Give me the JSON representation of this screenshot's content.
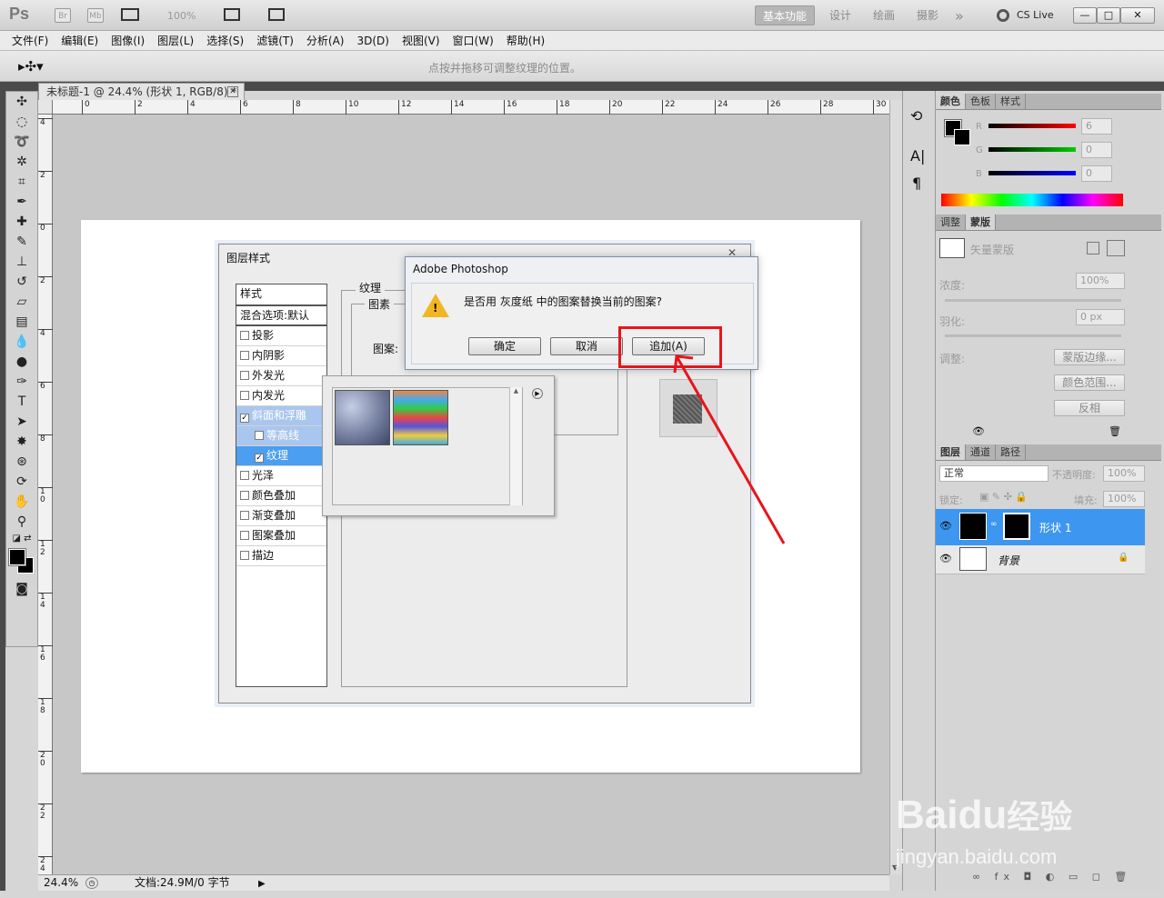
{
  "app": {
    "logo": "Ps",
    "br": "Br",
    "mb": "Mb",
    "zoom": "100%",
    "workspaces": [
      "基本功能",
      "设计",
      "绘画",
      "摄影"
    ],
    "more": "»",
    "cs_live": "CS Live",
    "win_min": "—",
    "win_max": "□",
    "win_close": "✕"
  },
  "menu": [
    "文件(F)",
    "编辑(E)",
    "图像(I)",
    "图层(L)",
    "选择(S)",
    "滤镜(T)",
    "分析(A)",
    "3D(D)",
    "视图(V)",
    "窗口(W)",
    "帮助(H)"
  ],
  "options_hint": "点按并拖移可调整纹理的位置。",
  "document": {
    "tab_title": "未标题-1 @ 24.4% (形状 1, RGB/8) *",
    "h_ruler": [
      "0",
      "2",
      "4",
      "6",
      "8",
      "10",
      "12",
      "14",
      "16",
      "18",
      "20",
      "22",
      "24",
      "26",
      "28",
      "30"
    ],
    "v_ruler": [
      "4",
      "2",
      "0",
      "2",
      "4",
      "6",
      "8",
      "1 0",
      "1 2",
      "1 4",
      "1 6",
      "1 8",
      "2 0",
      "2 2",
      "2 4"
    ],
    "zoom": "24.4%",
    "doc_info": "文档:24.9M/0 字节"
  },
  "layer_style_dialog": {
    "title": "图层样式",
    "styles_header": "样式",
    "blend_options": "混合选项:默认",
    "items": [
      {
        "label": "投影",
        "checked": false
      },
      {
        "label": "内阴影",
        "checked": false
      },
      {
        "label": "外发光",
        "checked": false
      },
      {
        "label": "内发光",
        "checked": false
      },
      {
        "label": "斜面和浮雕",
        "checked": true
      },
      {
        "label": "等高线",
        "checked": false
      },
      {
        "label": "纹理",
        "checked": true
      },
      {
        "label": "光泽",
        "checked": false
      },
      {
        "label": "颜色叠加",
        "checked": false
      },
      {
        "label": "渐变叠加",
        "checked": false
      },
      {
        "label": "图案叠加",
        "checked": false
      },
      {
        "label": "描边",
        "checked": false
      }
    ],
    "section_title": "纹理",
    "group_title": "图素",
    "pattern_label": "图案:"
  },
  "message_dialog": {
    "title": "Adobe Photoshop",
    "message": "是否用 灰度纸 中的图案替换当前的图案?",
    "ok": "确定",
    "cancel": "取消",
    "append": "追加(A)"
  },
  "color_panel": {
    "tabs": [
      "颜色",
      "色板",
      "样式"
    ],
    "r_label": "R",
    "g_label": "G",
    "b_label": "B",
    "r": "6",
    "g": "0",
    "b": "0"
  },
  "masks_panel": {
    "tabs": [
      "调整",
      "蒙版"
    ],
    "vector_mask": "矢量蒙版",
    "density_label": "浓度:",
    "density": "100%",
    "feather_label": "羽化:",
    "feather": "0 px",
    "refine_label": "调整:",
    "mask_edge": "蒙版边缘...",
    "color_range": "颜色范围...",
    "invert": "反相"
  },
  "layers_panel": {
    "tabs": [
      "图层",
      "通道",
      "路径"
    ],
    "blend_mode": "正常",
    "opacity_label": "不透明度:",
    "opacity": "100%",
    "lock_label": "锁定:",
    "fill_label": "填充:",
    "fill": "100%",
    "layers": [
      {
        "name": "形状 1",
        "selected": true
      },
      {
        "name": "背景",
        "selected": false
      }
    ]
  },
  "watermark": {
    "brand": "Bai",
    "brand2": "du",
    "cn": "经验",
    "url": "jingyan.baidu.com"
  },
  "colors": {
    "accent": "#e8141b",
    "selection": "#4b9ef0",
    "layer_selected": "#3d97f0"
  }
}
